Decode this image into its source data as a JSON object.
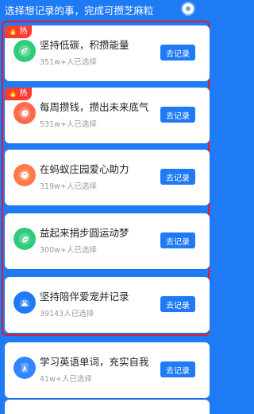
{
  "header": {
    "title": "选择想记录的事，完成可攒芝麻粒"
  },
  "cards": [
    {
      "hot": true,
      "hot_label": "热",
      "title": "坚持低碳，积攒能量",
      "subtitle": "351w+人已选择",
      "button": "去记录",
      "icon": "low-carbon-icon",
      "icon_color": "#2ecb7a"
    },
    {
      "hot": true,
      "hot_label": "热",
      "title": "每周攒钱，攒出未来底气",
      "subtitle": "531w+人已选择",
      "button": "去记录",
      "icon": "savings-icon",
      "icon_color": "#ff6b4a"
    },
    {
      "hot": false,
      "title": "在蚂蚁庄园爱心助力",
      "subtitle": "319w+人已选择",
      "button": "去记录",
      "icon": "ant-farm-icon",
      "icon_color": "#ff7a45"
    },
    {
      "hot": false,
      "title": "益起来捐步圆运动梦",
      "subtitle": "300w+人已选择",
      "button": "去记录",
      "icon": "walk-donate-icon",
      "icon_color": "#2ecb7a"
    },
    {
      "hot": false,
      "title": "坚持陪伴爱宠并记录",
      "subtitle": "39143人已选择",
      "button": "去记录",
      "icon": "pet-icon",
      "icon_color": "#1f7af6"
    },
    {
      "hot": false,
      "title": "学习英语单词，充实自我",
      "subtitle": "41w+人已选择",
      "button": "去记录",
      "icon": "english-icon",
      "icon_color": "#2f86ff"
    }
  ],
  "colors": {
    "background": "#1f7af6",
    "button": "#1f7af6",
    "hot_badge": "#ff3b30",
    "highlight_border": "#e31b23"
  }
}
